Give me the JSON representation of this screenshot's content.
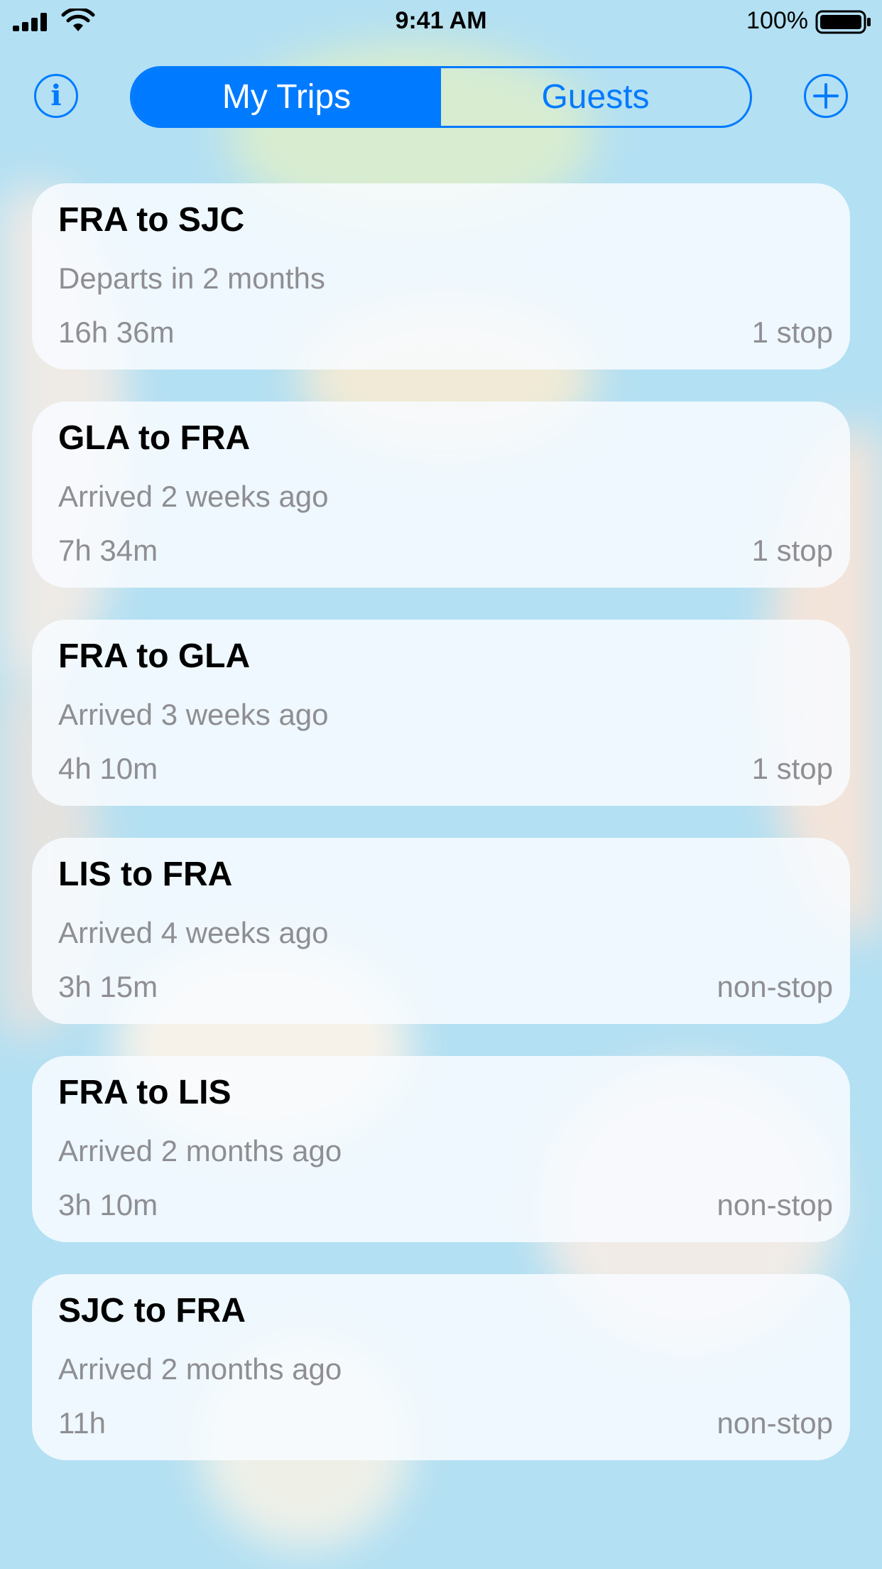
{
  "status_bar": {
    "time": "9:41 AM",
    "battery": "100%"
  },
  "nav": {
    "info_icon": "info-icon",
    "add_icon": "plus-icon",
    "segments": [
      {
        "label": "My Trips",
        "selected": true
      },
      {
        "label": "Guests",
        "selected": false
      }
    ]
  },
  "colors": {
    "accent": "#007aff",
    "secondary_text": "#8e8e93",
    "background": "#b3e0f3"
  },
  "trips": [
    {
      "route": "FRA to SJC",
      "status": "Departs in 2 months",
      "duration": "16h 36m",
      "stops": "1 stop"
    },
    {
      "route": "GLA to FRA",
      "status": "Arrived 2 weeks ago",
      "duration": "7h 34m",
      "stops": "1 stop"
    },
    {
      "route": "FRA to GLA",
      "status": "Arrived 3 weeks ago",
      "duration": "4h 10m",
      "stops": "1 stop"
    },
    {
      "route": "LIS to FRA",
      "status": "Arrived 4 weeks ago",
      "duration": "3h 15m",
      "stops": "non-stop"
    },
    {
      "route": "FRA to LIS",
      "status": "Arrived 2 months ago",
      "duration": "3h 10m",
      "stops": "non-stop"
    },
    {
      "route": "SJC to FRA",
      "status": "Arrived 2 months ago",
      "duration": "11h",
      "stops": "non-stop"
    }
  ]
}
